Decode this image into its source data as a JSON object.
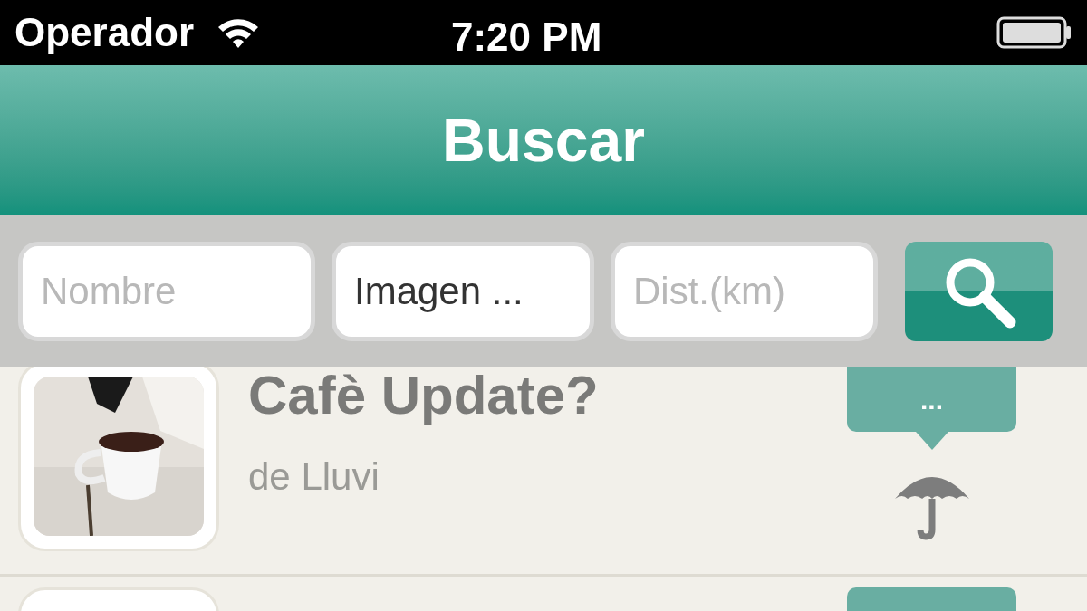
{
  "status_bar": {
    "carrier": "Operador",
    "time": "7:20 PM"
  },
  "nav_bar": {
    "title": "Buscar"
  },
  "search": {
    "fields": [
      {
        "placeholder": "Nombre"
      },
      {
        "value": "Imagen ..."
      },
      {
        "placeholder": "Dist.(km)"
      }
    ]
  },
  "results": [
    {
      "title": "Cafè Update?",
      "author": "de Lluvi",
      "bubble": "..."
    }
  ]
}
